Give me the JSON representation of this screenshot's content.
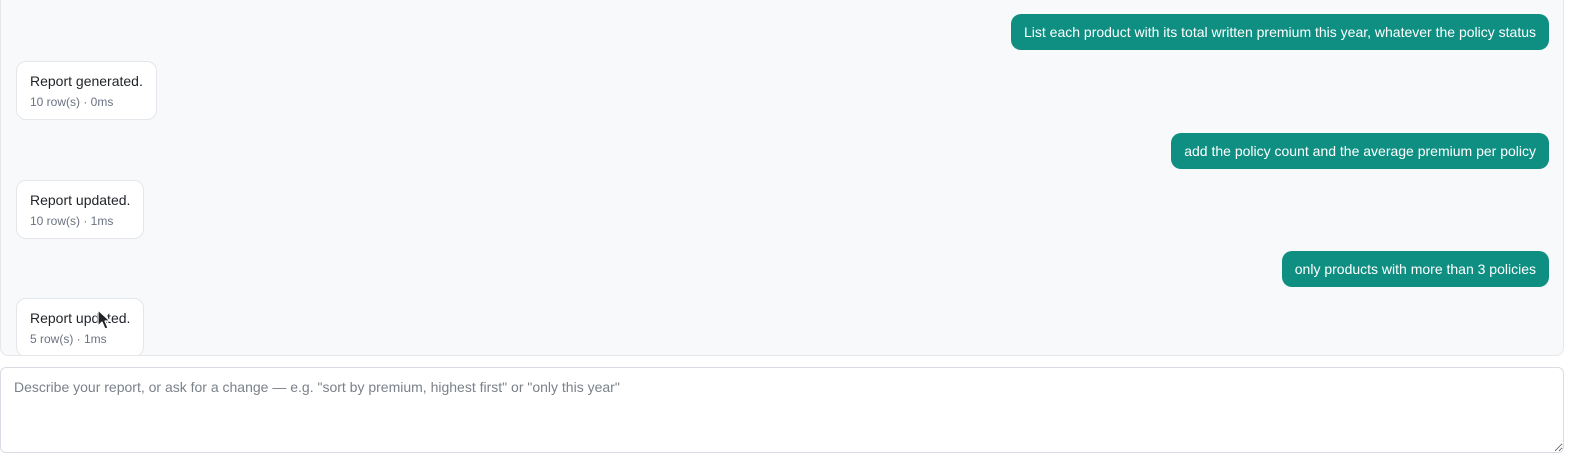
{
  "conversation": {
    "messages": [
      {
        "role": "user",
        "text": "List each product with its total written premium this year, whatever the policy status"
      },
      {
        "role": "assistant",
        "title": "Report generated.",
        "meta": "10 row(s) · 0ms"
      },
      {
        "role": "user",
        "text": "add the policy count and the average premium per policy"
      },
      {
        "role": "assistant",
        "title": "Report updated.",
        "meta": "10 row(s) · 1ms"
      },
      {
        "role": "user",
        "text": "only products with more than 3 policies"
      },
      {
        "role": "assistant",
        "title": "Report updated.",
        "meta": "5 row(s) · 1ms"
      }
    ]
  },
  "composer": {
    "value": "",
    "placeholder": "Describe your report, or ask for a change — e.g. \"sort by premium, highest first\" or \"only this year\""
  },
  "colors": {
    "user_bubble": "#0f8f82",
    "panel_background": "#f8f9fb"
  },
  "icons": {
    "pointer": "mouse-pointer-icon"
  }
}
